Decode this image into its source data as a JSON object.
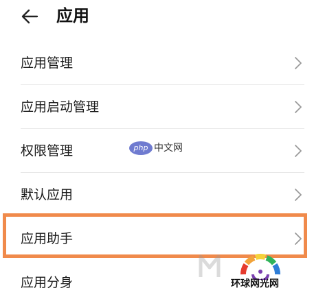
{
  "header": {
    "title": "应用",
    "back_icon": "arrow-left-icon"
  },
  "list": {
    "items": [
      {
        "label": "应用管理",
        "icon": "chevron-right-icon"
      },
      {
        "label": "应用启动管理",
        "icon": "chevron-right-icon"
      },
      {
        "label": "权限管理",
        "icon": "chevron-right-icon"
      },
      {
        "label": "默认应用",
        "icon": "chevron-right-icon"
      },
      {
        "label": "应用助手",
        "icon": "chevron-right-icon",
        "highlighted": true
      },
      {
        "label": "应用分身",
        "icon": "chevron-right-icon"
      }
    ]
  },
  "watermarks": {
    "php_badge": "php",
    "php_text": "中文网",
    "logo_text": "环球网光网"
  },
  "colors": {
    "highlight_border": "#f08a4b",
    "chevron": "#999999",
    "divider": "#e8e8e8",
    "text": "#1a1a1a"
  }
}
